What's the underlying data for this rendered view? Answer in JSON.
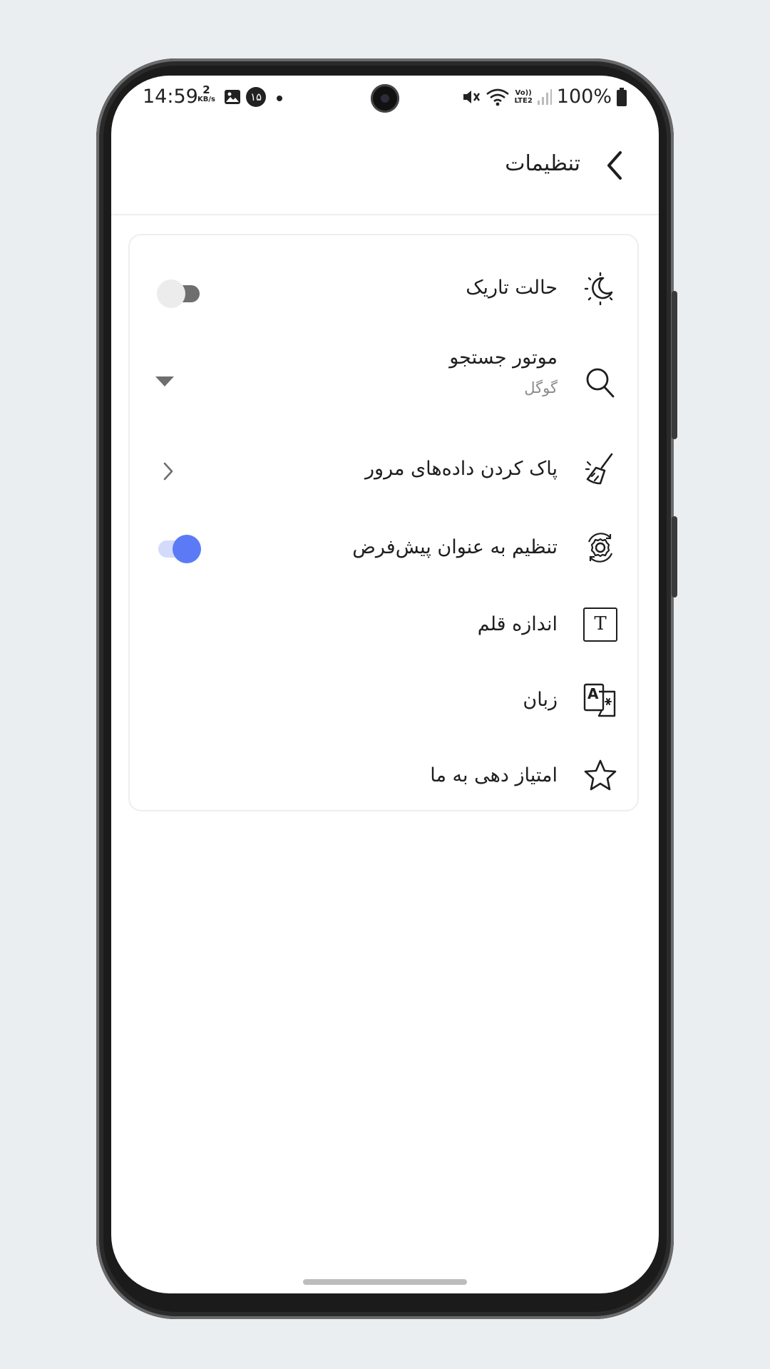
{
  "status_bar": {
    "time": "14:59",
    "net_speed_value": "2",
    "net_speed_unit": "KB/s",
    "notif_badge": "۱۵",
    "volte": "Vo))",
    "lte": "LTE2",
    "battery": "100%"
  },
  "header": {
    "title": "تنظیمات"
  },
  "settings": {
    "dark_mode": {
      "label": "حالت تاریک",
      "toggle_on": false,
      "icon": "moon-sun-icon"
    },
    "search_engine": {
      "label": "موتور جستجو",
      "value": "گوگل",
      "icon": "search-icon"
    },
    "clear_data": {
      "label": "پاک کردن داده‌های مرور",
      "icon": "broom-icon"
    },
    "set_default": {
      "label": "تنظیم به عنوان پیش‌فرض",
      "toggle_on": true,
      "icon": "gear-refresh-icon"
    },
    "font_size": {
      "label": "اندازه قلم",
      "icon": "text-size-icon",
      "icon_glyph": "T"
    },
    "language": {
      "label": "زبان",
      "icon": "translate-icon",
      "icon_glyph": "A"
    },
    "rate_us": {
      "label": "امتیاز دهی به ما",
      "icon": "star-icon"
    }
  },
  "colors": {
    "accent": "#5b7bf6",
    "accent_track": "#d3dafc",
    "background": "#ebeef1"
  }
}
